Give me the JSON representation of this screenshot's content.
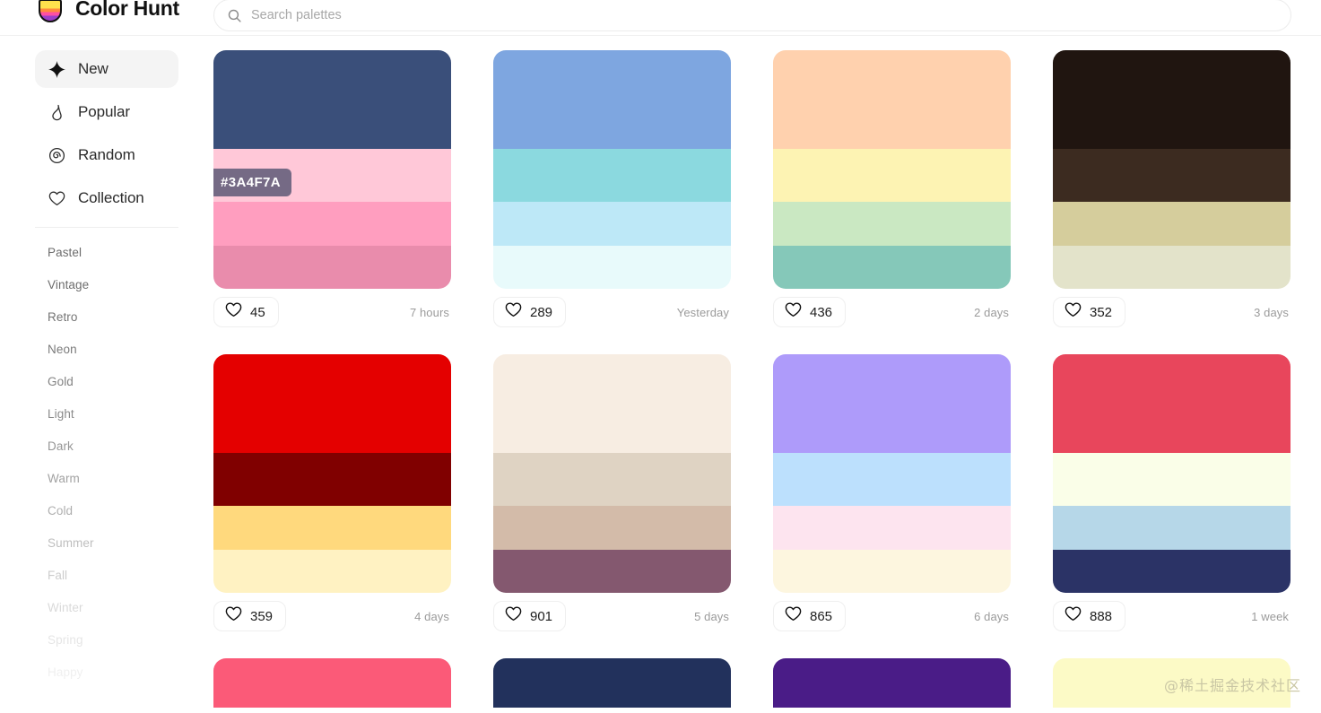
{
  "header": {
    "brand_name": "Color Hunt",
    "logo_icon": "colorhunt-cup-logo",
    "search": {
      "icon": "search-icon",
      "placeholder": "Search palettes",
      "value": ""
    }
  },
  "sidebar": {
    "nav": [
      {
        "label": "New",
        "icon": "sparkle-icon",
        "active": true
      },
      {
        "label": "Popular",
        "icon": "fire-icon",
        "active": false
      },
      {
        "label": "Random",
        "icon": "spiral-icon",
        "active": false
      },
      {
        "label": "Collection",
        "icon": "heart-icon",
        "active": false
      }
    ],
    "tags": [
      {
        "label": "Pastel",
        "opacity": 1.0
      },
      {
        "label": "Vintage",
        "opacity": 1.0
      },
      {
        "label": "Retro",
        "opacity": 0.95
      },
      {
        "label": "Neon",
        "opacity": 0.9
      },
      {
        "label": "Gold",
        "opacity": 0.85
      },
      {
        "label": "Light",
        "opacity": 0.8
      },
      {
        "label": "Dark",
        "opacity": 0.72
      },
      {
        "label": "Warm",
        "opacity": 0.64
      },
      {
        "label": "Cold",
        "opacity": 0.55
      },
      {
        "label": "Summer",
        "opacity": 0.44
      },
      {
        "label": "Fall",
        "opacity": 0.34
      },
      {
        "label": "Winter",
        "opacity": 0.25
      },
      {
        "label": "Spring",
        "opacity": 0.17
      },
      {
        "label": "Happy",
        "opacity": 0.1
      }
    ]
  },
  "main": {
    "palettes": [
      {
        "colors": [
          "#3A4F7A",
          "#FFC8D8",
          "#FF9EBF",
          "#E98CAC"
        ],
        "hex_overlay": "#3A4F7A",
        "likes": "45",
        "time": "7 hours",
        "clipped": false
      },
      {
        "colors": [
          "#7EA6E0",
          "#8BD9DF",
          "#BDE8F7",
          "#E8FAFB"
        ],
        "hex_overlay": null,
        "likes": "289",
        "time": "Yesterday",
        "clipped": false
      },
      {
        "colors": [
          "#FFD1AE",
          "#FDF3B3",
          "#CAE8C2",
          "#85C8B9"
        ],
        "hex_overlay": null,
        "likes": "436",
        "time": "2 days",
        "clipped": false
      },
      {
        "colors": [
          "#201510",
          "#3C2B20",
          "#D5CD9C",
          "#E3E3CA"
        ],
        "hex_overlay": null,
        "likes": "352",
        "time": "3 days",
        "clipped": false
      },
      {
        "colors": [
          "#E40000",
          "#800000",
          "#FFD97D",
          "#FFF2C2"
        ],
        "hex_overlay": null,
        "likes": "359",
        "time": "4 days",
        "clipped": false
      },
      {
        "colors": [
          "#F7EDE2",
          "#DFD3C3",
          "#D3BBA9",
          "#84586F"
        ],
        "hex_overlay": null,
        "likes": "901",
        "time": "5 days",
        "clipped": false
      },
      {
        "colors": [
          "#AE9BFA",
          "#BCE0FD",
          "#FDE4EF",
          "#FDF6DF"
        ],
        "hex_overlay": null,
        "likes": "865",
        "time": "6 days",
        "clipped": false
      },
      {
        "colors": [
          "#E8465C",
          "#FAFEE8",
          "#B6D7E8",
          "#2B3366"
        ],
        "hex_overlay": null,
        "likes": "888",
        "time": "1 week",
        "clipped": false
      },
      {
        "colors": [
          "#FB5A78",
          "#FB5A78",
          "#FB5A78",
          "#FB5A78"
        ],
        "hex_overlay": null,
        "likes": "",
        "time": "",
        "clipped": true
      },
      {
        "colors": [
          "#22315C",
          "#22315C",
          "#22315C",
          "#22315C"
        ],
        "hex_overlay": null,
        "likes": "",
        "time": "",
        "clipped": true
      },
      {
        "colors": [
          "#4A1C87",
          "#4A1C87",
          "#4A1C87",
          "#4A1C87"
        ],
        "hex_overlay": null,
        "likes": "",
        "time": "",
        "clipped": true
      },
      {
        "colors": [
          "#FCFAC6",
          "#FCFAC6",
          "#FCFAC6",
          "#FCFAC6"
        ],
        "hex_overlay": null,
        "likes": "",
        "time": "",
        "clipped": true
      }
    ]
  },
  "watermark": {
    "text": "@稀土掘金技术社区"
  }
}
